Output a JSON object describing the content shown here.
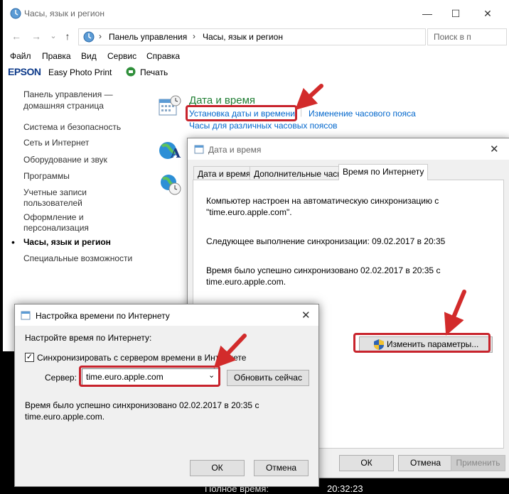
{
  "window": {
    "title": "Часы, язык и регион",
    "minimize": "—",
    "maximize": "☐",
    "close": "✕"
  },
  "addressbar": {
    "back": "←",
    "forward": "→",
    "dropdown": "⌄",
    "up": "↑",
    "crumbs": [
      "Панель управления",
      "Часы, язык и регион"
    ],
    "separator": "›",
    "search_placeholder": "Поиск в п"
  },
  "menu": [
    "Файл",
    "Правка",
    "Вид",
    "Сервис",
    "Справка"
  ],
  "epson": {
    "logo": "EPSON",
    "easy": "Easy Photo Print",
    "print": "Печать"
  },
  "sidebar": {
    "home_line1": "Панель управления —",
    "home_line2": "домашняя страница",
    "items": [
      "Система и безопасность",
      "Сеть и Интернет",
      "Оборудование и звук",
      "Программы"
    ],
    "accounts_line1": "Учетные записи",
    "accounts_line2": "пользователей",
    "design_line1": "Оформление и",
    "design_line2": "персонализация",
    "current": "Часы, язык и регион",
    "access": "Специальные возможности"
  },
  "main": {
    "section_title": "Дата и время",
    "link_set": "Установка даты и времени",
    "link_timezone": "Изменение часового пояса",
    "link_clocks": "Часы для различных часовых поясов"
  },
  "dt_dialog": {
    "title": "Дата и время",
    "tabs": [
      "Дата и время",
      "Дополнительные часы",
      "Время по Интернету"
    ],
    "text1_line1": "Компьютер настроен на автоматическую синхронизацию с",
    "text1_line2": "\"time.euro.apple.com\".",
    "text2": "Следующее выполнение синхронизации: 09.02.2017 в 20:35",
    "text3_line1": "Время было успешно синхронизовано 02.02.2017 в 20:35 с",
    "text3_line2": "time.euro.apple.com.",
    "change_button": "Изменить параметры...",
    "ok": "ОК",
    "cancel": "Отмена",
    "apply": "Применить"
  },
  "it_dialog": {
    "title": "Настройка времени по Интернету",
    "heading": "Настройте время по Интернету:",
    "sync_label": "Синхронизировать с сервером времени в Интернете",
    "server_label": "Сервер:",
    "server_value": "time.euro.apple.com",
    "update_button": "Обновить сейчас",
    "status_line1": "Время было успешно синхронизовано 02.02.2017 в 20:35 с",
    "status_line2": "time.euro.apple.com.",
    "ok": "ОК",
    "cancel": "Отмена"
  },
  "background": {
    "bottom_label": "Полное время:",
    "bottom_time": "20:32:23"
  },
  "colors": {
    "accent_red": "#c8232c",
    "link_blue": "#0066cc",
    "section_green": "#1e7d32"
  }
}
